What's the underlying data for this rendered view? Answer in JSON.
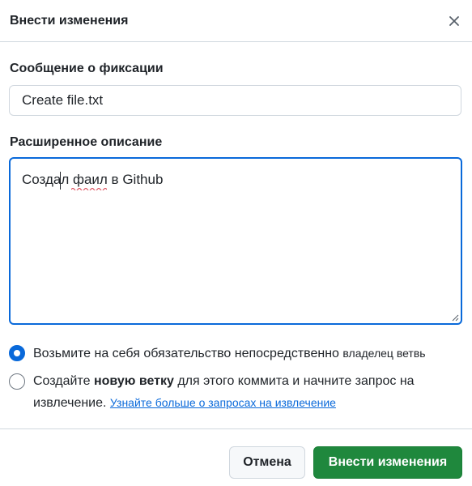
{
  "dialog": {
    "title": "Внести изменения",
    "close_icon": "x-icon"
  },
  "commit_message": {
    "label": "Сообщение о фиксации",
    "value": "Create file.txt"
  },
  "description": {
    "label": "Расширенное описание",
    "value": "Создал фаил в Github"
  },
  "options": {
    "direct": {
      "text": "Возьмите на себя обязательство непосредственно",
      "suffix": "владелец ветвь",
      "selected": true
    },
    "new_branch": {
      "text_before": "Создайте",
      "text_bold": "новую ветку",
      "text_after": "для этого коммита и начните запрос на извлечение.",
      "link": "Узнайте больше о запросах на извлечение",
      "selected": false
    }
  },
  "buttons": {
    "cancel": "Отмена",
    "commit": "Внести изменения"
  },
  "colors": {
    "accent": "#0969da",
    "primary_button": "#1f883d",
    "border": "#d0d7de"
  }
}
